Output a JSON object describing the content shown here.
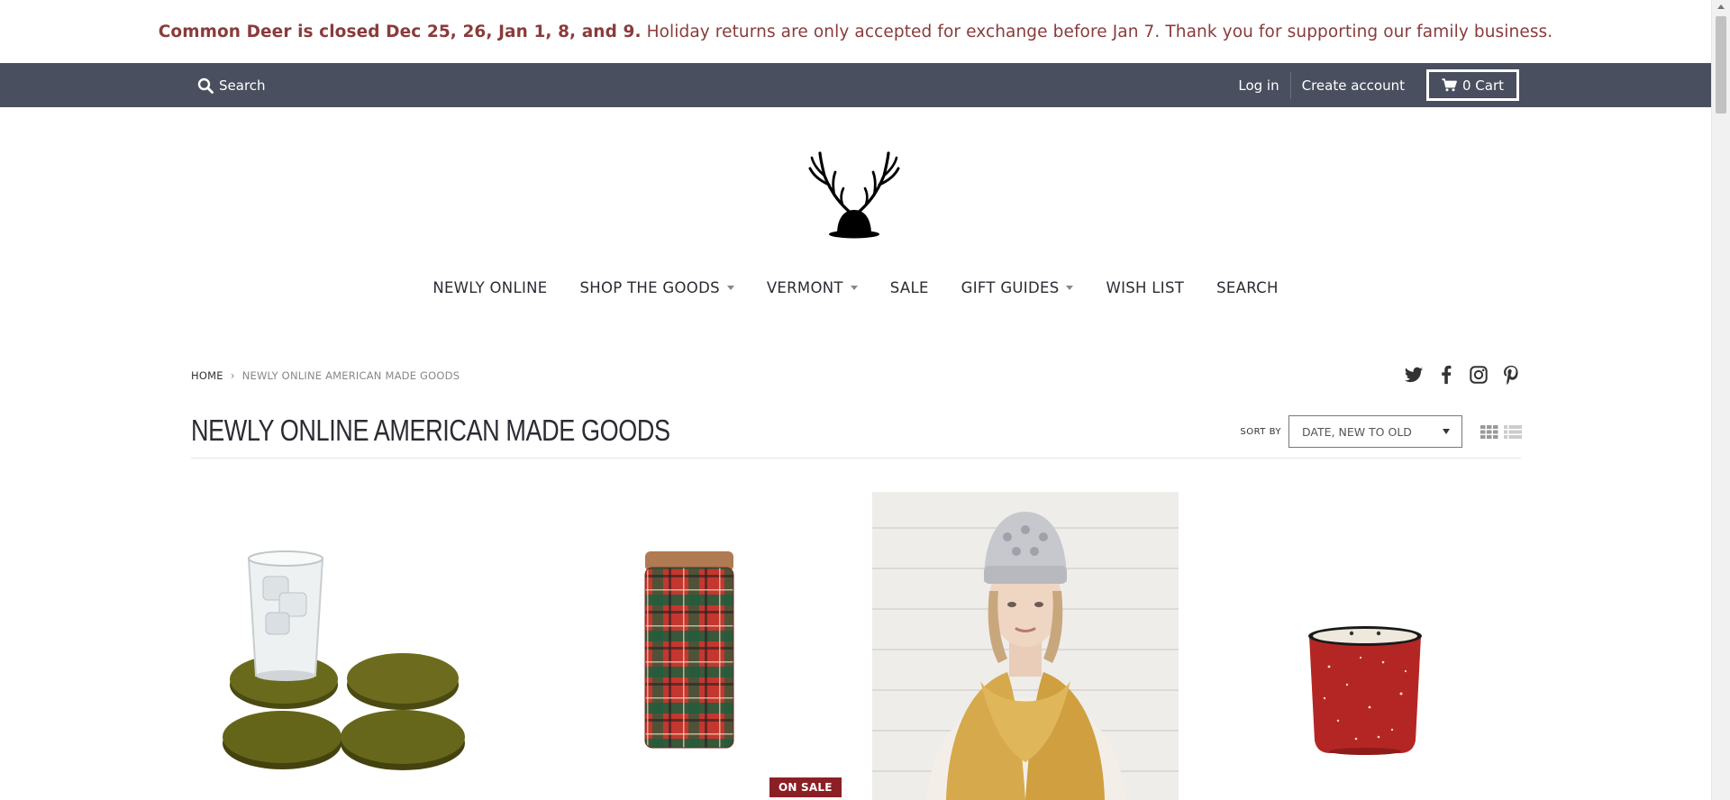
{
  "announcement": {
    "bold": "Common Deer is closed Dec 25, 26, Jan 1, 8, and 9.",
    "text": "Holiday returns are only accepted for exchange before Jan 7. Thank you for supporting our family business."
  },
  "topbar": {
    "search_label": "Search",
    "login_label": "Log in",
    "create_account_label": "Create account",
    "cart_label": "0 Cart"
  },
  "nav": {
    "items": [
      {
        "label": "NEWLY ONLINE",
        "dropdown": false
      },
      {
        "label": "SHOP THE GOODS",
        "dropdown": true
      },
      {
        "label": "VERMONT",
        "dropdown": true
      },
      {
        "label": "SALE",
        "dropdown": false
      },
      {
        "label": "GIFT GUIDES",
        "dropdown": true
      },
      {
        "label": "WISH LIST",
        "dropdown": false
      },
      {
        "label": "SEARCH",
        "dropdown": false
      }
    ]
  },
  "breadcrumb": {
    "home": "HOME",
    "separator": "›",
    "current": "NEWLY ONLINE AMERICAN MADE GOODS"
  },
  "social": [
    "twitter-icon",
    "facebook-icon",
    "instagram-icon",
    "pinterest-icon"
  ],
  "collection": {
    "title": "NEWLY ONLINE AMERICAN MADE GOODS",
    "sort_label": "SORT BY",
    "sort_value": "DATE, NEW TO OLD"
  },
  "products": {
    "sale_badge": "ON SALE"
  },
  "colors": {
    "announcement_text": "#8a3b3b",
    "topbar_bg": "#4a4f5f",
    "sale_badge_bg": "#8b1f26"
  }
}
